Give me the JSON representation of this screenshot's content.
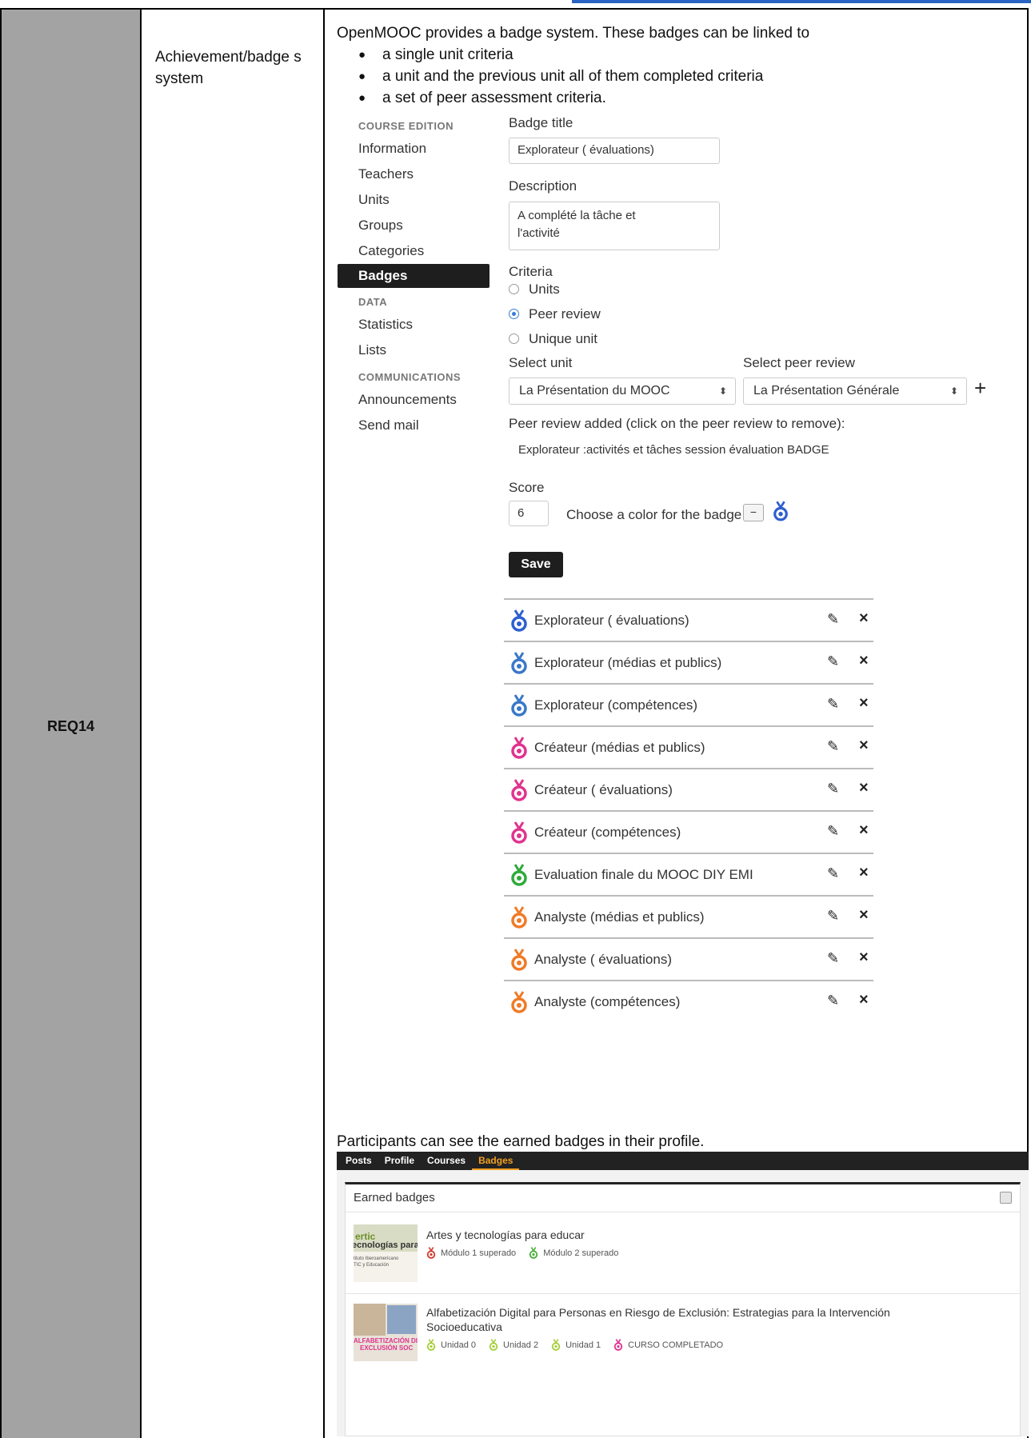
{
  "requirement": {
    "id": "REQ14",
    "name": "Achievement/badge s system"
  },
  "description": {
    "intro": "OpenMOOC provides a badge system.  These badges can be linked to",
    "bullets": [
      "a single unit criteria",
      "a unit and the previous unit all of them completed criteria",
      "a set of peer assessment criteria."
    ],
    "outro": "Participants can see the earned badges in their profile."
  },
  "sidebar": {
    "sections": [
      {
        "heading": "COURSE EDITION",
        "items": [
          "Information",
          "Teachers",
          "Units",
          "Groups",
          "Categories",
          "Badges"
        ]
      },
      {
        "heading": "DATA",
        "items": [
          "Statistics",
          "Lists"
        ]
      },
      {
        "heading": "COMMUNICATIONS",
        "items": [
          "Announcements",
          "Send mail"
        ]
      }
    ],
    "active_item": "Badges"
  },
  "badge_form": {
    "title_label": "Badge title",
    "title_value": "Explorateur ( évaluations)",
    "description_label": "Description",
    "description_value_line1": "A complété la tâche et",
    "description_value_line2": "l'activité",
    "criteria_label": "Criteria",
    "criteria_options": [
      "Units",
      "Peer review",
      "Unique unit"
    ],
    "criteria_selected": "Peer review",
    "select_unit_label": "Select unit",
    "select_unit_value": "La Présentation du MOOC",
    "select_peer_label": "Select peer review",
    "select_peer_value": "La Présentation Générale",
    "add_symbol": "+",
    "peer_added_label": "Peer review added (click on the peer review to remove):",
    "peer_added_item": "Explorateur :activités et tâches session évaluation BADGE",
    "score_label": "Score",
    "score_value": "6",
    "color_label": "Choose a color for the badge",
    "color_minus": "−",
    "badge_color": "#2d5fd0",
    "save_label": "Save"
  },
  "badges": [
    {
      "name": "Explorateur ( évaluations)",
      "color": "#2d5fd0"
    },
    {
      "name": "Explorateur (médias et publics)",
      "color": "#3a78c8"
    },
    {
      "name": "Explorateur (compétences)",
      "color": "#3a78c8"
    },
    {
      "name": "Créateur (médias et publics)",
      "color": "#e0338f"
    },
    {
      "name": "Créateur ( évaluations)",
      "color": "#e0338f"
    },
    {
      "name": "Créateur (compétences)",
      "color": "#e0338f"
    },
    {
      "name": "Evaluation finale du MOOC DIY EMI",
      "color": "#2faa3a"
    },
    {
      "name": "Analyste (médias et publics)",
      "color": "#f07a26"
    },
    {
      "name": "Analyste ( évaluations)",
      "color": "#f07a26"
    },
    {
      "name": "Analyste (compétences)",
      "color": "#f07a26"
    }
  ],
  "profile": {
    "tabs": [
      "Posts",
      "Profile",
      "Courses",
      "Badges"
    ],
    "active_tab": "Badges",
    "earned_title": "Earned badges",
    "courses": [
      {
        "title": "Artes y tecnologías para educar",
        "thumb_line1": "ertic",
        "thumb_line2": "ecnologías para ed",
        "thumb_line3": "tituto Iberoamericano",
        "thumb_line4": "TIC y Educación",
        "badges": [
          {
            "label": "Módulo 1 superado",
            "color": "#d63a2e"
          },
          {
            "label": "Módulo 2 superado",
            "color": "#4caf3a"
          }
        ]
      },
      {
        "title_line1": "Alfabetización Digital para Personas en Riesgo de Exclusión: Estrategias para la Intervención",
        "title_line2": "Socioeducativa",
        "thumb_line1": "ALFABETIZACIÓN DIGI",
        "thumb_line2": "EXCLUSIÓN SOC",
        "badges": [
          {
            "label": "Unidad 0",
            "color": "#a6cf3a"
          },
          {
            "label": "Unidad 2",
            "color": "#a6cf3a"
          },
          {
            "label": "Unidad 1",
            "color": "#a6cf3a"
          },
          {
            "label": "CURSO COMPLETADO",
            "color": "#e0338f"
          }
        ]
      }
    ]
  }
}
